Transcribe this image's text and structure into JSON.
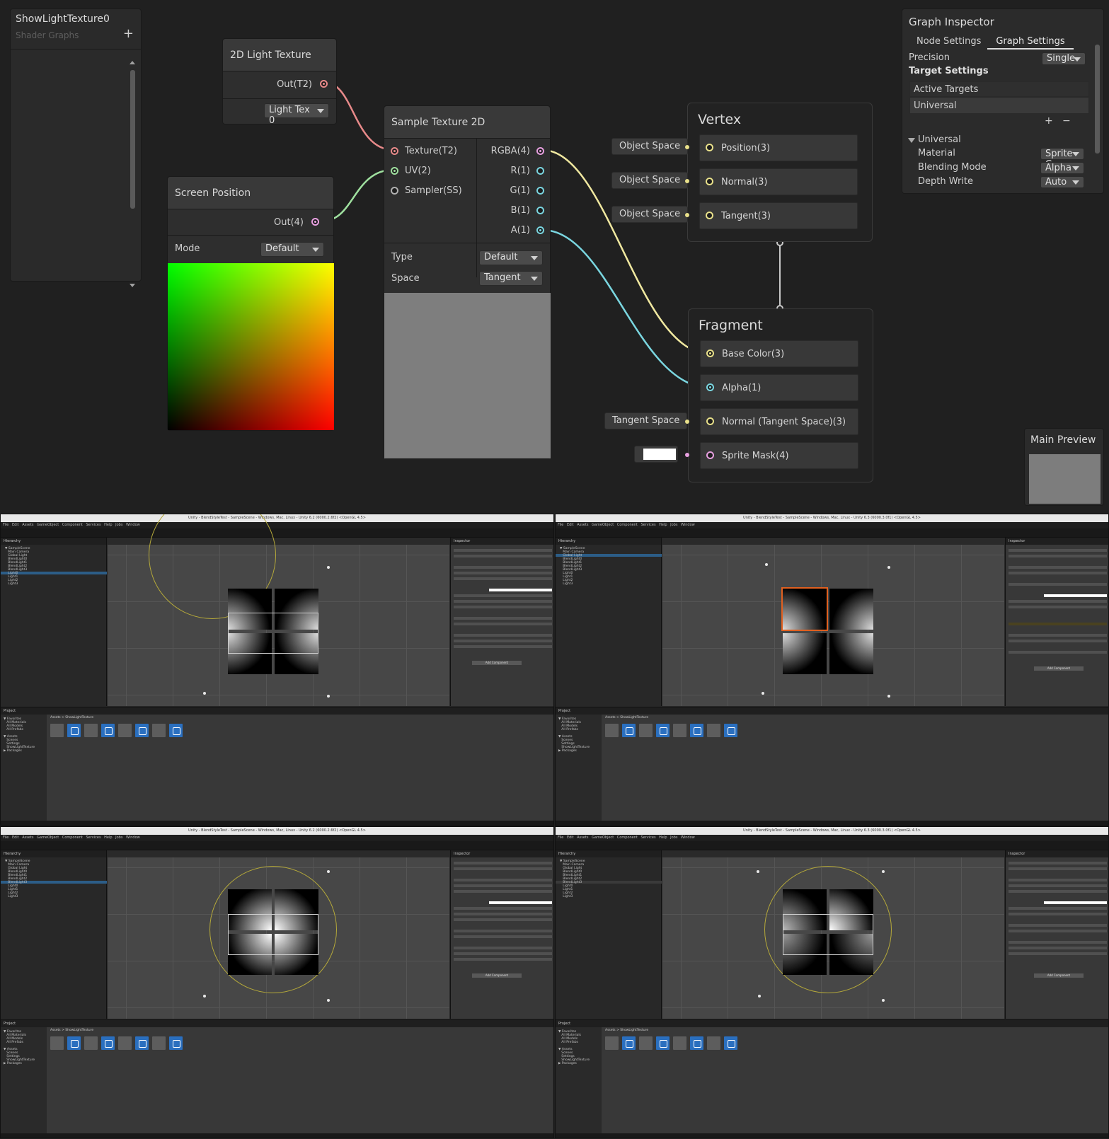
{
  "blackboard": {
    "title": "ShowLightTexture0",
    "subtitle": "Shader Graphs",
    "add_label": "+"
  },
  "nodes": {
    "light_texture": {
      "title": "2D Light Texture",
      "out_label": "Out(T2)",
      "dropdown": "Light Tex 0"
    },
    "screen_position": {
      "title": "Screen Position",
      "out_label": "Out(4)",
      "mode_label": "Mode",
      "mode_value": "Default"
    },
    "sample_texture": {
      "title": "Sample Texture 2D",
      "inputs": [
        "Texture(T2)",
        "UV(2)",
        "Sampler(SS)"
      ],
      "outputs": [
        "RGBA(4)",
        "R(1)",
        "G(1)",
        "B(1)",
        "A(1)"
      ],
      "type_label": "Type",
      "type_value": "Default",
      "space_label": "Space",
      "space_value": "Tangent"
    }
  },
  "vertex": {
    "title": "Vertex",
    "slots": [
      "Position(3)",
      "Normal(3)",
      "Tangent(3)"
    ],
    "chips": [
      "Object Space",
      "Object Space",
      "Object Space"
    ]
  },
  "fragment": {
    "title": "Fragment",
    "slots": [
      "Base Color(3)",
      "Alpha(1)",
      "Normal (Tangent Space)(3)",
      "Sprite Mask(4)"
    ],
    "chips": [
      "Tangent Space"
    ]
  },
  "graph_inspector": {
    "title": "Graph Inspector",
    "tabs": [
      "Node Settings",
      "Graph Settings"
    ],
    "active_tab": "Graph Settings",
    "precision_label": "Precision",
    "precision_value": "Single",
    "target_settings": "Target Settings",
    "active_targets": "Active Targets",
    "target_item": "Universal",
    "add": "+",
    "remove": "−",
    "section": "Universal",
    "props": [
      {
        "label": "Material",
        "value": "Sprite C"
      },
      {
        "label": "Blending Mode",
        "value": "Alpha"
      },
      {
        "label": "Depth Write",
        "value": "Auto"
      }
    ]
  },
  "main_preview": {
    "title": "Main Preview"
  },
  "editors": {
    "title_left": "Unity - BlendStyleTest - SampleScene - Windows, Mac, Linux - Unity 6.2 (6000.2.6f2) <OpenGL 4.5>",
    "title_right": "Unity - BlendStyleTest - SampleScene - Windows, Mac, Linux - Unity 6.3 (6000.3.0f1) <OpenGL 4.5>",
    "menu": "File Edit Assets GameObject Component Services Help Jobs Window",
    "hierarchy_label": "Hierarchy",
    "project_label": "Project",
    "console_label": "Console",
    "inspector_label": "Inspector",
    "scene_tree": "▼ SampleScene\n   Main Camera\n   Global Light\n   BlendLight0\n   BlendLight1\n   BlendLight2\n   BlendLight3\n   Light0\n   Light1\n   Light2\n   Light3",
    "folders": "▼ Favorites\n   All Materials\n   All Models\n   All Prefabs\n\n▼ Assets\n   Scenes\n   Settings\n   ShowLightTexture\n▶ Packages",
    "breadcrumb": "Assets > ShowLightTexture",
    "add_component": "Add Component"
  },
  "colors": {
    "wire_texture": "#e88a8a",
    "wire_uv": "#9fe09f",
    "wire_vector4": "#e8a0e0",
    "wire_vector3": "#e8e08a",
    "wire_float": "#7ad6e0",
    "port_grey": "#b0b0b0"
  }
}
